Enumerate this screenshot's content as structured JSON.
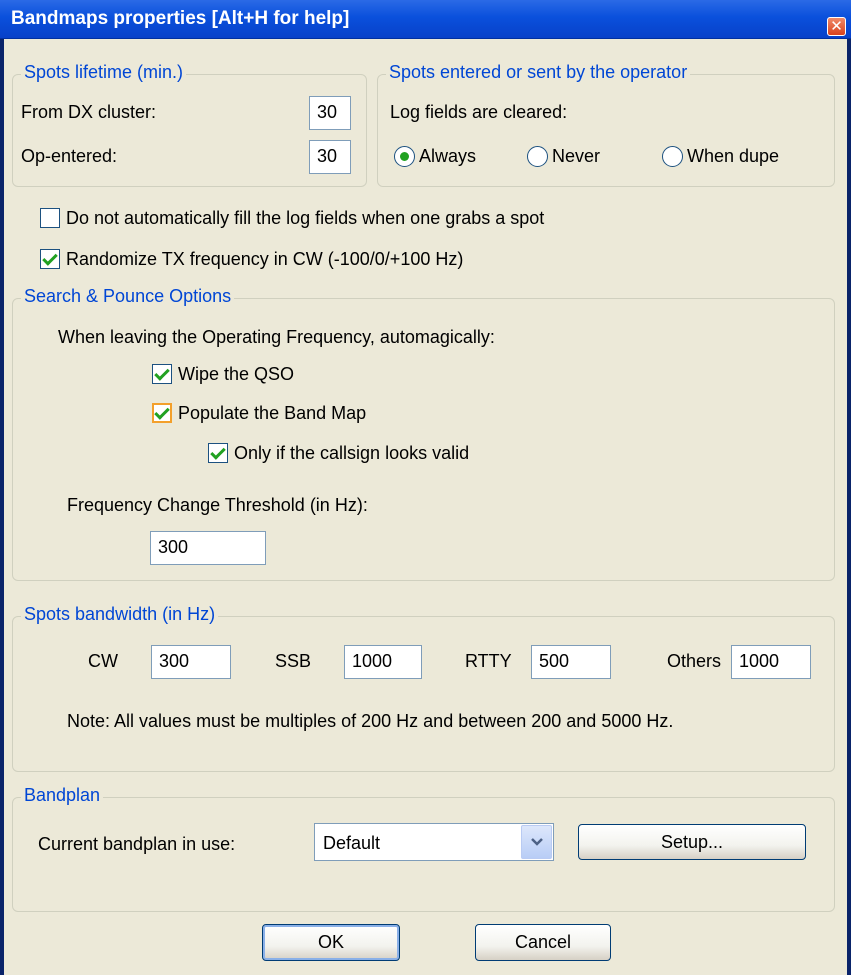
{
  "window": {
    "title": "Bandmaps properties [Alt+H for help]",
    "close_glyph": "✕"
  },
  "lifetime": {
    "legend": "Spots lifetime (min.)",
    "dx_label": "From DX cluster:",
    "dx_value": "30",
    "op_label": "Op-entered:",
    "op_value": "30"
  },
  "operator": {
    "legend": "Spots entered or sent by the operator",
    "cleared_label": "Log fields are cleared:",
    "options": [
      "Always",
      "Never",
      "When dupe"
    ],
    "selected": "Always"
  },
  "options": {
    "no_autofill": {
      "label": "Do not automatically fill the log fields when one grabs a spot",
      "checked": false
    },
    "randomize_tx": {
      "label": "Randomize TX frequency in CW (-100/0/+100 Hz)",
      "checked": true
    }
  },
  "snp": {
    "legend": "Search & Pounce Options",
    "intro": "When leaving the Operating Frequency, automagically:",
    "wipe": {
      "label": "Wipe the QSO",
      "checked": true
    },
    "populate": {
      "label": "Populate the Band Map",
      "checked": true
    },
    "only_valid": {
      "label": "Only if the callsign looks valid",
      "checked": true
    },
    "threshold_label": "Frequency Change Threshold (in Hz):",
    "threshold_value": "300"
  },
  "bandwidth": {
    "legend": "Spots bandwidth (in Hz)",
    "cw_label": "CW",
    "cw_value": "300",
    "ssb_label": "SSB",
    "ssb_value": "1000",
    "rtty_label": "RTTY",
    "rtty_value": "500",
    "others_label": "Others",
    "others_value": "1000",
    "note": "Note: All values must be multiples of 200 Hz and between 200 and 5000 Hz."
  },
  "bandplan": {
    "legend": "Bandplan",
    "label": "Current bandplan in use:",
    "value": "Default",
    "setup_label": "Setup..."
  },
  "buttons": {
    "ok": "OK",
    "cancel": "Cancel"
  },
  "colors": {
    "titlebar": "#0a50dc",
    "group_title": "#0046d5",
    "check": "#21a121",
    "face": "#ece9d8"
  }
}
